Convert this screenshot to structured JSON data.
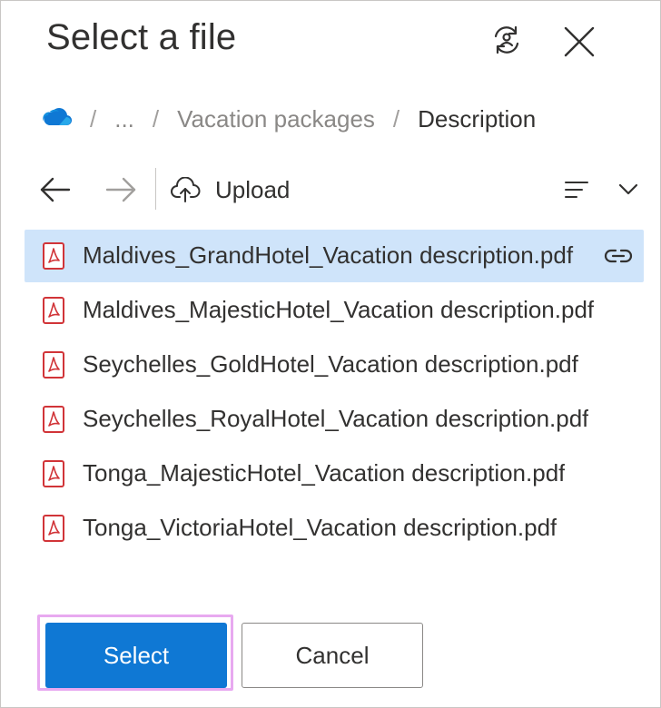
{
  "dialog": {
    "title": "Select a file",
    "switch_account_icon": "switch-account-icon",
    "close_icon": "close-icon"
  },
  "breadcrumb": {
    "root_icon": "onedrive-cloud-icon",
    "items": [
      {
        "label": "..."
      },
      {
        "label": "Vacation packages"
      },
      {
        "label": "Description"
      }
    ],
    "separator": "/"
  },
  "toolbar": {
    "back_icon": "arrow-left-icon",
    "forward_icon": "arrow-right-icon",
    "upload_label": "Upload",
    "upload_icon": "cloud-upload-icon",
    "sort_icon": "sort-lines-icon",
    "dropdown_icon": "chevron-down-icon"
  },
  "files": [
    {
      "name": "Maldives_GrandHotel_Vacation description.pdf",
      "selected": true,
      "shared": true
    },
    {
      "name": "Maldives_MajesticHotel_Vacation description.pdf",
      "selected": false
    },
    {
      "name": "Seychelles_GoldHotel_Vacation description.pdf",
      "selected": false
    },
    {
      "name": "Seychelles_RoyalHotel_Vacation description.pdf",
      "selected": false
    },
    {
      "name": "Tonga_MajesticHotel_Vacation description.pdf",
      "selected": false
    },
    {
      "name": "Tonga_VictoriaHotel_Vacation description.pdf",
      "selected": false
    }
  ],
  "footer": {
    "select_label": "Select",
    "cancel_label": "Cancel"
  },
  "colors": {
    "accent": "#0f78d4",
    "selected_row": "#cfe4fa",
    "pdf_red": "#d13438",
    "highlight_outline": "#e8a9f0"
  }
}
